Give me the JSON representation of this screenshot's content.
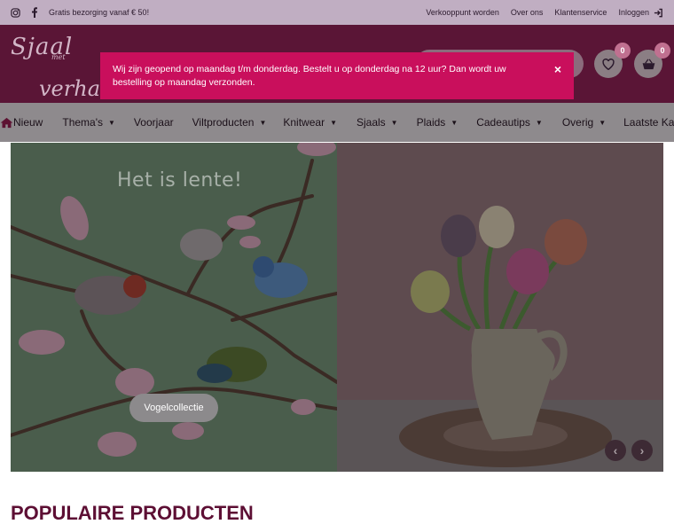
{
  "topbar": {
    "shipping_text": "Gratis bezorging vanaf € 50!",
    "links": [
      "Verkooppunt worden",
      "Over ons",
      "Klantenservice"
    ],
    "login_label": "Inloggen"
  },
  "logo": {
    "line1": "Sjaal",
    "line2": "met",
    "line3": "verhaal"
  },
  "header": {
    "wishlist_count": "0",
    "cart_count": "0"
  },
  "notice": {
    "text": "Wij zijn geopend op maandag t/m donderdag. Bestelt u op donderdag na 12 uur? Dan wordt uw bestelling op maandag verzonden.",
    "close_symbol": "×"
  },
  "nav": {
    "items": [
      {
        "label": "Nieuw",
        "dropdown": false
      },
      {
        "label": "Thema's",
        "dropdown": true
      },
      {
        "label": "Voorjaar",
        "dropdown": false
      },
      {
        "label": "Viltproducten",
        "dropdown": true
      },
      {
        "label": "Knitwear",
        "dropdown": true
      },
      {
        "label": "Sjaals",
        "dropdown": true
      },
      {
        "label": "Plaids",
        "dropdown": true
      },
      {
        "label": "Cadeautips",
        "dropdown": true
      },
      {
        "label": "Overig",
        "dropdown": true
      },
      {
        "label": "Laatste Kans!",
        "dropdown": false
      }
    ]
  },
  "slider": {
    "heading": "Het is lente!",
    "cta_label": "Vogelcollectie",
    "prev_symbol": "‹",
    "next_symbol": "›"
  },
  "section": {
    "title": "POPULAIRE PRODUCTEN"
  },
  "colors": {
    "overlay_header": "#5a1536",
    "notice_bg": "#c90f5c",
    "section_title": "#5d0f34"
  }
}
